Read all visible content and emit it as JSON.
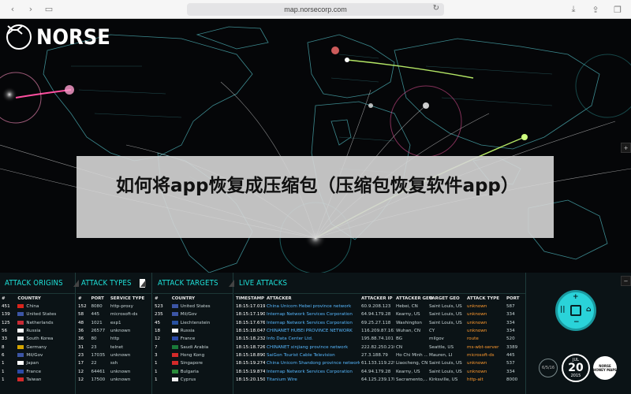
{
  "browser": {
    "url": "map.norsecorp.com",
    "icons": [
      "chevron-left-icon",
      "chevron-right-icon",
      "sidebar-icon",
      "reload-icon",
      "download-icon",
      "share-icon",
      "tabs-icon",
      "new-tab-icon"
    ]
  },
  "logo": {
    "text": "NORSE"
  },
  "banner": {
    "text": "如何将app恢复成压缩包（压缩包恢复软件app）"
  },
  "attack_origins": {
    "title": "ATTACK ORIGINS",
    "headers": [
      "#",
      "COUNTRY"
    ],
    "rows": [
      {
        "count": "451",
        "country": "China",
        "flag": "#d9251c"
      },
      {
        "count": "139",
        "country": "United States",
        "flag": "#3c55a5"
      },
      {
        "count": "125",
        "country": "Netherlands",
        "flag": "#c82a34"
      },
      {
        "count": "56",
        "country": "Russia",
        "flag": "#ffffff"
      },
      {
        "count": "33",
        "country": "South Korea",
        "flag": "#eeeeee"
      },
      {
        "count": "8",
        "country": "Germany",
        "flag": "#d4a400"
      },
      {
        "count": "6",
        "country": "Mil/Gov",
        "flag": "#3c55a5"
      },
      {
        "count": "1",
        "country": "Japan",
        "flag": "#ffffff"
      },
      {
        "count": "1",
        "country": "France",
        "flag": "#2c4aa8"
      },
      {
        "count": "1",
        "country": "Taiwan",
        "flag": "#d42a2a"
      }
    ]
  },
  "attack_types": {
    "title": "ATTACK TYPES",
    "headers": [
      "#",
      "PORT",
      "SERVICE TYPE"
    ],
    "rows": [
      {
        "count": "152",
        "port": "8080",
        "service": "http-proxy"
      },
      {
        "count": "58",
        "port": "445",
        "service": "microsoft-ds"
      },
      {
        "count": "48",
        "port": "1021",
        "service": "exp1"
      },
      {
        "count": "36",
        "port": "26577",
        "service": "unknown"
      },
      {
        "count": "36",
        "port": "80",
        "service": "http"
      },
      {
        "count": "31",
        "port": "23",
        "service": "telnet"
      },
      {
        "count": "23",
        "port": "17035",
        "service": "unknown"
      },
      {
        "count": "17",
        "port": "22",
        "service": "ssh"
      },
      {
        "count": "12",
        "port": "64461",
        "service": "unknown"
      },
      {
        "count": "12",
        "port": "17500",
        "service": "unknown"
      }
    ]
  },
  "attack_targets": {
    "title": "ATTACK TARGETS",
    "headers": [
      "#",
      "COUNTRY"
    ],
    "rows": [
      {
        "count": "523",
        "country": "United States",
        "flag": "#3c55a5"
      },
      {
        "count": "235",
        "country": "Mil/Gov",
        "flag": "#3c55a5"
      },
      {
        "count": "45",
        "country": "Liechtenstein",
        "flag": "#2850a0"
      },
      {
        "count": "18",
        "country": "Russia",
        "flag": "#ffffff"
      },
      {
        "count": "12",
        "country": "France",
        "flag": "#2c4aa8"
      },
      {
        "count": "7",
        "country": "Saudi Arabia",
        "flag": "#1a7a3a"
      },
      {
        "count": "3",
        "country": "Hong Kong",
        "flag": "#d42a2a"
      },
      {
        "count": "1",
        "country": "Singapore",
        "flag": "#d42a2a"
      },
      {
        "count": "1",
        "country": "Bulgaria",
        "flag": "#2a8a3a"
      },
      {
        "count": "1",
        "country": "Cyprus",
        "flag": "#eeeeee"
      }
    ]
  },
  "live_attacks": {
    "title": "LIVE ATTACKS",
    "headers": [
      "TIMESTAMP",
      "ATTACKER",
      "ATTACKER IP",
      "ATTACKER GEO",
      "TARGET GEO",
      "ATTACK TYPE",
      "PORT"
    ],
    "rows": [
      {
        "ts": "18:15:17.019",
        "attacker": "China Unicom Hebei province network",
        "ip": "60.9.208.123",
        "ageo": "Hebei, CN",
        "tgeo": "Saint Louis, US",
        "type": "unknown",
        "port": "587"
      },
      {
        "ts": "18:15:17.190",
        "attacker": "Internap Network Services Corporation",
        "ip": "64.94.179.28",
        "ageo": "Kearny, US",
        "tgeo": "Saint Louis, US",
        "type": "unknown",
        "port": "334"
      },
      {
        "ts": "18:15:17.676",
        "attacker": "Internap Network Services Corporation",
        "ip": "69.25.27.118",
        "ageo": "Washington",
        "tgeo": "Saint Louis, US",
        "type": "unknown",
        "port": "334"
      },
      {
        "ts": "18:15:18.047",
        "attacker": "CHINANET HUBEI PROVINCE NETWORK",
        "ip": "116.209.87.161",
        "ageo": "Wuhan, CN",
        "tgeo": "CY",
        "type": "unknown",
        "port": "334"
      },
      {
        "ts": "18:15:18.232",
        "attacker": "Info Data Center Ltd.",
        "ip": "195.88.74.101",
        "ageo": "BG",
        "tgeo": "milgov",
        "type": "route",
        "port": "520"
      },
      {
        "ts": "18:15:18.726",
        "attacker": "CHINANET xinjiang province network",
        "ip": "222.82.250.210",
        "ageo": "CN",
        "tgeo": "Seattle, US",
        "type": "ms-wbt-server",
        "port": "3389"
      },
      {
        "ts": "18:15:18.890",
        "attacker": "SaiGon Tourist Cable Television",
        "ip": "27.3.188.79",
        "ageo": "Ho Chi Minh ...",
        "tgeo": "Mauren, LI",
        "type": "microsoft-ds",
        "port": "445"
      },
      {
        "ts": "18:15:19.274",
        "attacker": "China Unicom Shandong province network",
        "ip": "61.133.119.229",
        "ageo": "Liaocheng, CN",
        "tgeo": "Saint Louis, US",
        "type": "unknown",
        "port": "537"
      },
      {
        "ts": "18:15:19.874",
        "attacker": "Internap Network Services Corporation",
        "ip": "64.94.179.28",
        "ageo": "Kearny, US",
        "tgeo": "Saint Louis, US",
        "type": "unknown",
        "port": "334"
      },
      {
        "ts": "18:15:20.150",
        "attacker": "Titanium Wire",
        "ip": "64.125.239.178",
        "ageo": "Sacramento,...",
        "tgeo": "Kirksville, US",
        "type": "http-alt",
        "port": "8000"
      }
    ]
  },
  "widgets": {
    "control_labels": [
      "+",
      "−",
      "||",
      "⌂"
    ],
    "badge1": "6/5/16",
    "date_month": "JUL",
    "date_day": "20",
    "date_year": "2015",
    "badge3": "NORSE HONEY MAPS",
    "side_plus": "+",
    "side_minus": "−"
  },
  "colors": {
    "accent": "#1ee0d8",
    "attack_line": "#ffffff",
    "arc_pink": "#ff4fa0",
    "arc_green": "#8aff6a"
  }
}
